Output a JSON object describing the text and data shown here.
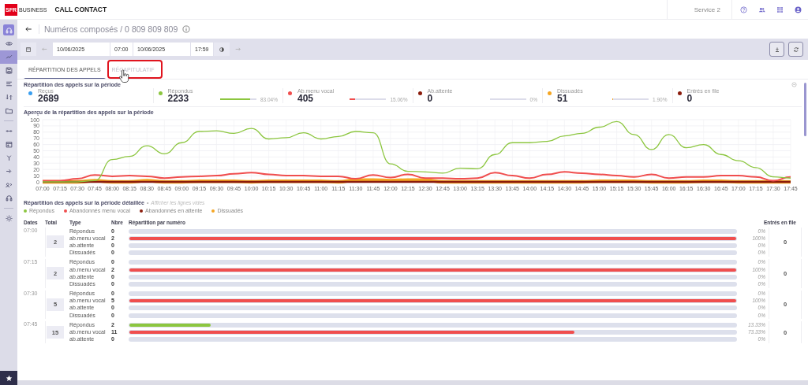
{
  "topbar": {
    "logo": "SFR",
    "brand": "BUSINESS",
    "app_title": "CALL CONTACT",
    "service": "Service 2"
  },
  "sidebar": {
    "items": [
      {
        "selected": true
      },
      {
        "selected": false
      },
      {
        "selected": true
      },
      {
        "selected": false
      },
      {
        "selected": false
      },
      {
        "selected": false
      },
      {
        "selected": false
      },
      {
        "selected": false
      },
      {
        "selected": false
      },
      {
        "selected": false
      },
      {
        "selected": false
      },
      {
        "selected": false
      },
      {
        "selected": false
      },
      {
        "selected": false
      }
    ]
  },
  "header": {
    "title": "Numéros composés / 0 809 809 809"
  },
  "toolbar": {
    "start_date": "10/06/2025",
    "start_time": "07:00",
    "end_date": "10/06/2025",
    "end_time": "17:59"
  },
  "tabs": [
    {
      "label": "RÉPARTITION DES APPELS",
      "selected": true,
      "highlighted": false
    },
    {
      "label": "RÉCAPITULATIF",
      "selected": false,
      "highlighted": true
    }
  ],
  "summary": {
    "title": "Répartition des appels sur la période",
    "stats": [
      {
        "label": "Reçus",
        "value": "2689",
        "color": "#3a9ff0"
      },
      {
        "label": "Répondus",
        "value": "2233",
        "color": "#8cc63f",
        "level": 0.8304,
        "percent": "83.04%"
      },
      {
        "label": "Ab.menu vocal",
        "value": "405",
        "color": "#f04e4e",
        "level": 0.1506,
        "percent": "15.06%"
      },
      {
        "label": "Ab.attente",
        "value": "0",
        "color": "#8b1c0c",
        "percent": "0%"
      },
      {
        "label": "Dissuadés",
        "value": "51",
        "color": "#f5a623",
        "level": 0.019,
        "percent": "1.90%"
      },
      {
        "label": "Entrés en file",
        "value": "0",
        "color": "#8b1c0c"
      }
    ]
  },
  "overview": {
    "title": "Aperçu de la répartition des appels sur la période",
    "chart_data": {
      "type": "line",
      "categories": [
        "07:00",
        "07:15",
        "07:30",
        "07:45",
        "08:00",
        "08:15",
        "08:30",
        "08:45",
        "09:00",
        "09:15",
        "09:30",
        "09:45",
        "10:00",
        "10:15",
        "10:30",
        "10:45",
        "11:00",
        "11:15",
        "11:30",
        "11:45",
        "12:00",
        "12:15",
        "12:30",
        "12:45",
        "13:00",
        "13:15",
        "13:30",
        "13:45",
        "14:00",
        "14:15",
        "14:30",
        "14:45",
        "15:00",
        "15:15",
        "15:30",
        "15:45",
        "16:00",
        "16:15",
        "16:30",
        "16:45",
        "17:00",
        "17:15",
        "17:30",
        "17:45"
      ],
      "series": [
        {
          "name": "Répondus",
          "color": "#8cc63f",
          "values": [
            0,
            0,
            0,
            2,
            36,
            41,
            58,
            45,
            63,
            81,
            82,
            78,
            86,
            69,
            71,
            79,
            69,
            73,
            81,
            79,
            29,
            17,
            16,
            14,
            22,
            21,
            44,
            63,
            63,
            65,
            74,
            78,
            88,
            97,
            76,
            52,
            76,
            55,
            60,
            44,
            34,
            23,
            8,
            6
          ]
        },
        {
          "name": "Abandonnés menu vocal",
          "color": "#f04e4e",
          "values": [
            2,
            2,
            5,
            11,
            9,
            10,
            9,
            6,
            8,
            9,
            10,
            13,
            15,
            12,
            10,
            10,
            9,
            9,
            5,
            11,
            7,
            12,
            6,
            6,
            5,
            6,
            15,
            10,
            6,
            12,
            16,
            14,
            12,
            10,
            8,
            12,
            6,
            8,
            8,
            10,
            10,
            8,
            2,
            8
          ]
        },
        {
          "name": "Abandonnés en attente",
          "color": "#8b1c0c",
          "values": [
            0,
            0,
            0,
            0,
            0,
            0,
            0,
            0,
            0,
            0,
            0,
            0,
            0,
            0,
            0,
            0,
            0,
            0,
            0,
            0,
            0,
            0,
            0,
            0,
            0,
            0,
            0,
            0,
            0,
            0,
            0,
            0,
            0,
            0,
            0,
            0,
            0,
            0,
            0,
            0,
            0,
            0,
            0,
            0
          ]
        },
        {
          "name": "Dissuadés",
          "color": "#f5a623",
          "values": [
            0,
            0,
            0,
            2,
            0,
            0,
            2,
            0,
            0,
            1,
            1,
            1,
            0,
            1,
            1,
            1,
            1,
            0,
            3,
            3,
            2,
            3,
            3,
            0,
            0,
            0,
            0,
            0,
            0,
            0,
            0,
            0,
            1,
            1,
            1,
            0,
            0,
            0,
            1,
            1,
            0,
            0,
            0,
            0
          ]
        }
      ],
      "grid": true,
      "ylim": [
        0,
        100
      ],
      "yticks": [
        0,
        10,
        20,
        30,
        40,
        50,
        60,
        70,
        80,
        90,
        100
      ]
    }
  },
  "detail": {
    "title": "Répartition des appels sur la période détaillée",
    "separator": "•",
    "toggle_link": "Afficher les lignes vides",
    "columns": [
      "Dates",
      "Total",
      "Type",
      "Nbre",
      "Répartition par numéro",
      "Entrés en file"
    ],
    "groups": [
      {
        "date": "07:00",
        "total": "2",
        "entered": "0",
        "lines": [
          {
            "type": "Répondus",
            "count": "0",
            "percent": "0%"
          },
          {
            "type": "ab.menu vocal",
            "count": "2",
            "level": 1,
            "percent": "100%"
          },
          {
            "type": "ab.attente",
            "count": "0",
            "percent": "0%"
          },
          {
            "type": "Dissuadés",
            "count": "0",
            "percent": "0%"
          }
        ]
      },
      {
        "date": "07:15",
        "total": "2",
        "entered": "0",
        "lines": [
          {
            "type": "Répondus",
            "count": "0",
            "percent": "0%"
          },
          {
            "type": "ab.menu vocal",
            "count": "2",
            "level": 1,
            "percent": "100%"
          },
          {
            "type": "ab.attente",
            "count": "0",
            "percent": "0%"
          },
          {
            "type": "Dissuadés",
            "count": "0",
            "percent": "0%"
          }
        ]
      },
      {
        "date": "07:30",
        "total": "5",
        "entered": "0",
        "lines": [
          {
            "type": "Répondus",
            "count": "0",
            "percent": "0%"
          },
          {
            "type": "ab.menu vocal",
            "count": "5",
            "level": 1,
            "percent": "100%"
          },
          {
            "type": "ab.attente",
            "count": "0",
            "percent": "0%"
          },
          {
            "type": "Dissuadés",
            "count": "0",
            "percent": "0%"
          }
        ]
      },
      {
        "date": "07:45",
        "total": "15",
        "entered": "0",
        "lines": [
          {
            "type": "Répondus",
            "count": "2",
            "level": 0.1333,
            "percent": "13.33%"
          },
          {
            "type": "ab.menu vocal",
            "count": "11",
            "level": 0.7333,
            "percent": "73.33%"
          },
          {
            "type": "ab.attente",
            "count": "0",
            "percent": "0%"
          }
        ]
      }
    ]
  }
}
